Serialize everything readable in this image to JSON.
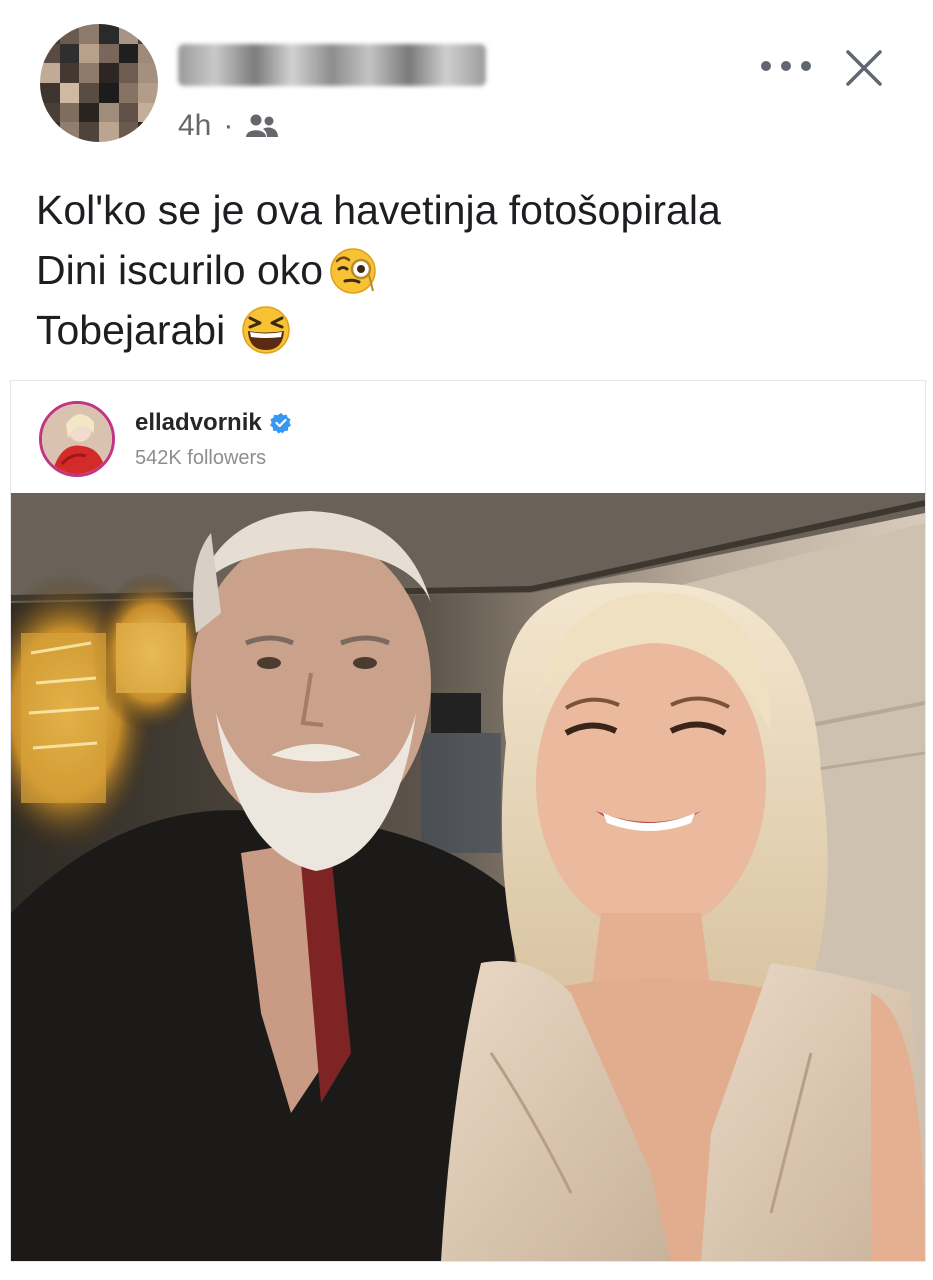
{
  "post": {
    "time": "4h",
    "dot": "·",
    "audience_icon": "friends-icon",
    "text_lines": [
      "Kol'ko se je ova havetinja fotošopirala",
      "Dini iscurilo oko",
      "Tobejarabi"
    ],
    "emojis": [
      "face-with-monocle-emoji",
      "grinning-squinting-face-emoji"
    ]
  },
  "actions": {
    "more_icon": "more-horizontal-icon",
    "close_icon": "close-icon"
  },
  "shared": {
    "username": "elladvornik",
    "verified_icon": "verified-badge-icon",
    "followers": "542K followers"
  },
  "colors": {
    "text": "#1c1e21",
    "secondary": "#65676b",
    "verified": "#3897f0"
  }
}
